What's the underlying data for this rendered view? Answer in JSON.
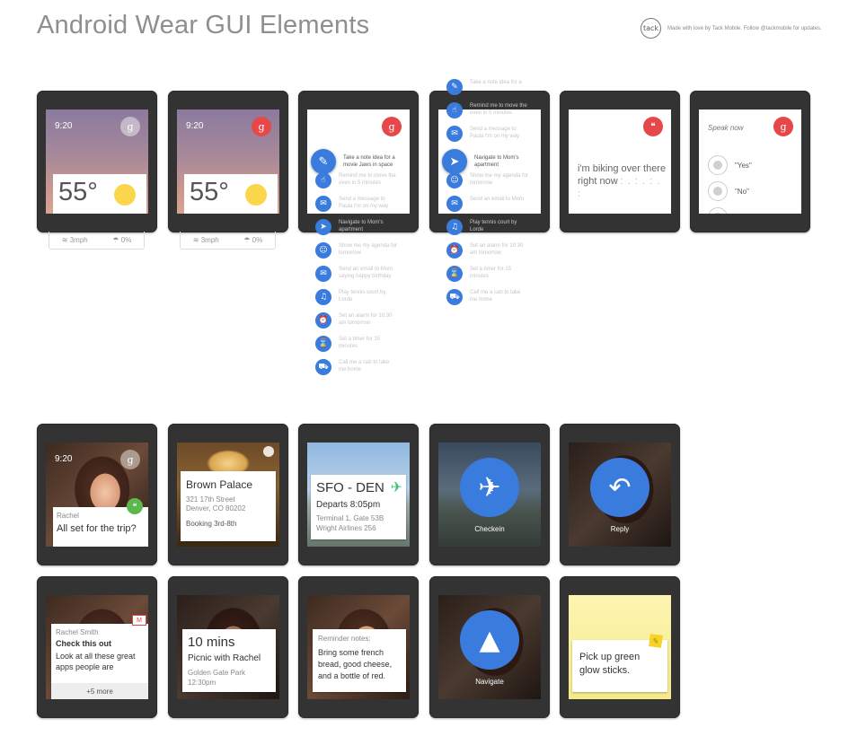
{
  "page": {
    "title": "Android Wear GUI Elements",
    "logo_text": "tack",
    "credit": "Made with love by Tack Mobile. Follow @tackmobile for updates."
  },
  "weather_cards": [
    {
      "time": "9:20",
      "badge": "g",
      "temp": "55°",
      "wind": "3mph",
      "rain": "0%"
    },
    {
      "time": "9:20",
      "badge": "g",
      "temp": "55°",
      "wind": "3mph",
      "rain": "0%"
    }
  ],
  "voice_list_1": {
    "badge": "g",
    "items": [
      {
        "icon": "✎",
        "text": "Take a note idea for a movie Jaws in space",
        "active": true
      },
      {
        "icon": "☝",
        "text": "Remind me to move the oven in 5 minutes",
        "active": false
      },
      {
        "icon": "✉",
        "text": "Send a message to Paula I'm on my way",
        "active": false
      },
      {
        "icon": "➤",
        "text": "Navigate to Mom's apartment",
        "active": false
      },
      {
        "icon": "☺",
        "text": "Show me my agenda for tomorrow",
        "active": false
      },
      {
        "icon": "✉",
        "text": "Send an email to Mom saying happy birthday",
        "active": false
      },
      {
        "icon": "♫",
        "text": "Play tennis court by Lorde",
        "active": false
      },
      {
        "icon": "⏰",
        "text": "Set an alarm for 10:30 am tomorrow",
        "active": false
      },
      {
        "icon": "⌛",
        "text": "Set a timer for 15 minutes",
        "active": false
      },
      {
        "icon": "⛟",
        "text": "Call me a cab to take me home",
        "active": false
      }
    ]
  },
  "voice_list_2": {
    "items": [
      {
        "icon": "✎",
        "text": "Take a note idea for a",
        "active": false
      },
      {
        "icon": "☝",
        "text": "Remind me to move the oven in 5 minutes",
        "active": false
      },
      {
        "icon": "✉",
        "text": "Send a message to Paula I'm on my way",
        "active": false
      },
      {
        "icon": "➤",
        "text": "Navigate to Mom's apartment",
        "active": true
      },
      {
        "icon": "☺",
        "text": "Show me my agenda for tomorrow",
        "active": false
      },
      {
        "icon": "✉",
        "text": "Send an email to Mom",
        "active": false
      },
      {
        "icon": "♫",
        "text": "Play tennis court by Lorde",
        "active": false
      },
      {
        "icon": "⏰",
        "text": "Set an alarm for 10:30 am tomorrow",
        "active": false
      },
      {
        "icon": "⌛",
        "text": "Set a timer for 15 minutes",
        "active": false
      },
      {
        "icon": "⛟",
        "text": "Call me a cab to take me home",
        "active": false
      }
    ]
  },
  "dictation": {
    "text": "i'm biking over there right now",
    "dots": ": . : . : . :"
  },
  "speak_now": {
    "label": "Speak now",
    "badge": "g",
    "options": [
      "\"Yes\"",
      "\"No\""
    ]
  },
  "cards_row2": {
    "rachel": {
      "time": "9:20",
      "badge": "g",
      "name": "Rachel",
      "message": "All set for the trip?"
    },
    "place": {
      "name": "Brown Palace",
      "address1": "321 17th Street",
      "address2": "Denver, CO 80202",
      "booking": "Booking 3rd-8th"
    },
    "flight": {
      "route": "SFO - DEN",
      "departs": "Departs 8:05pm",
      "terminal": "Terminal 1, Gate 53B",
      "airline": "Wright Airlines 256"
    },
    "checkin": {
      "label": "Checkein"
    },
    "reply": {
      "label": "Reply"
    }
  },
  "cards_row3": {
    "email": {
      "name": "Rachel Smith",
      "subject": "Check this out",
      "body": "Look at all these great apps people are",
      "more": "+5 more"
    },
    "event": {
      "time": "10 mins",
      "title": "Picnic with Rachel",
      "location": "Golden Gate Park",
      "when": "12:30pm"
    },
    "reminder": {
      "label": "Reminder notes:",
      "text": "Bring some french bread, good cheese, and a bottle of red."
    },
    "navigate": {
      "label": "Navigate"
    },
    "note": {
      "text": "Pick up green glow sticks."
    }
  },
  "colors": {
    "accent_blue": "#3a7bde",
    "google_red": "#e6484a",
    "watch_body": "#333333",
    "sun": "#fbd64a"
  }
}
